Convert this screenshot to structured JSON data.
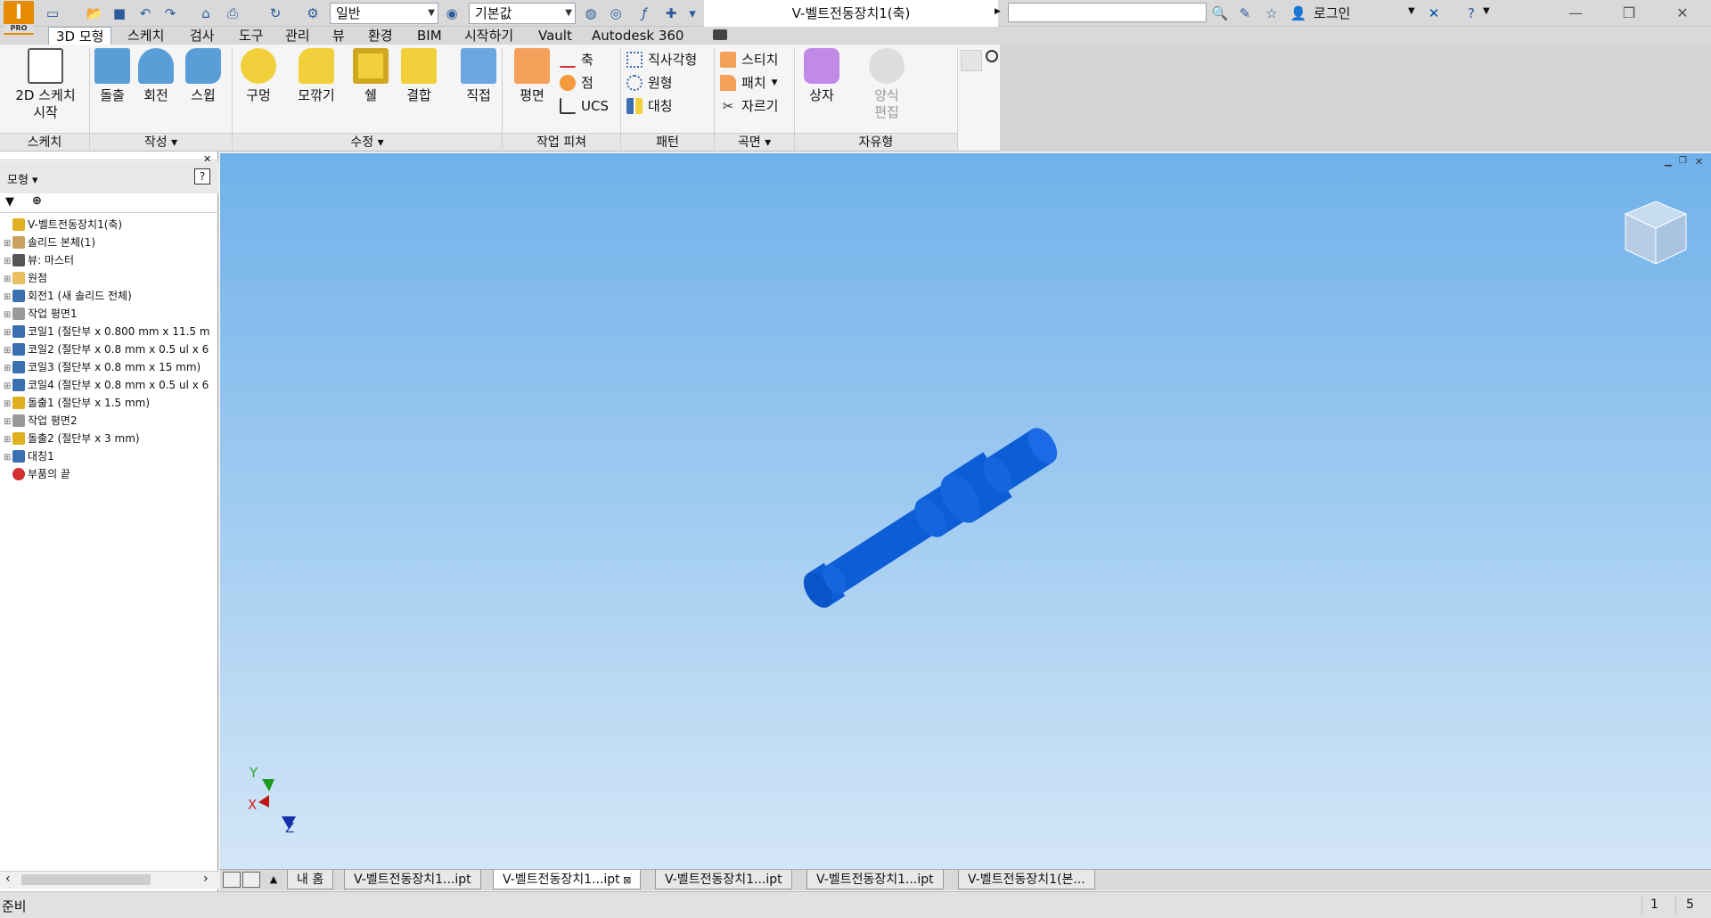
{
  "app": {
    "badge": "PRO"
  },
  "title": "V-벨트전동장치1(축)",
  "quick_access": {
    "style_dropdown": "일반",
    "material_dropdown": "기본값"
  },
  "login_label": "로그인",
  "menu_tabs": [
    "3D 모형",
    "스케치",
    "검사",
    "도구",
    "관리",
    "뷰",
    "환경",
    "BIM",
    "시작하기",
    "Vault",
    "Autodesk 360"
  ],
  "ribbon": {
    "sketch": {
      "button": "2D 스케치\n시작",
      "panel": "스케치"
    },
    "create": {
      "buttons": [
        "돌출",
        "회전",
        "스윕"
      ],
      "panel": "작성"
    },
    "modify": {
      "buttons": [
        "구멍",
        "모깎기",
        "쉘",
        "결합"
      ],
      "panel": "수정"
    },
    "direct": {
      "button": "직접"
    },
    "work_features": {
      "button": "평면",
      "small": [
        "축",
        "점",
        "UCS"
      ],
      "panel": "작업 피쳐"
    },
    "pattern": {
      "small": [
        "직사각형",
        "원형",
        "대칭"
      ],
      "panel": "패턴"
    },
    "surface": {
      "small": [
        "스티치",
        "패치",
        "자르기"
      ],
      "panel": "곡면"
    },
    "freeform": {
      "buttons": [
        "상자",
        "양식\n편집"
      ],
      "panel": "자유형"
    }
  },
  "browser": {
    "title": "모형",
    "tree": [
      {
        "label": "V-벨트전동장치1(축)",
        "color": "#e0b020"
      },
      {
        "label": "솔리드 본체(1)",
        "color": "#c8a060"
      },
      {
        "label": "뷰: 마스터",
        "color": "#555555"
      },
      {
        "label": "원점",
        "color": "#e8c060"
      },
      {
        "label": "회전1 (새 솔리드 전체)",
        "color": "#3a6fb0"
      },
      {
        "label": "작업 평면1",
        "color": "#999999"
      },
      {
        "label": "코일1 (절단부 x 0.800 mm x 11.5 m",
        "color": "#3a6fb0"
      },
      {
        "label": "코일2 (절단부 x 0.8 mm x 0.5 ul x 6",
        "color": "#3a6fb0"
      },
      {
        "label": "코일3 (절단부 x 0.8 mm x 15 mm)",
        "color": "#3a6fb0"
      },
      {
        "label": "코일4 (절단부 x 0.8 mm x 0.5 ul x 6",
        "color": "#3a6fb0"
      },
      {
        "label": "돌출1 (절단부 x 1.5 mm)",
        "color": "#e0b020"
      },
      {
        "label": "작업 평면2",
        "color": "#999999"
      },
      {
        "label": "돌출2 (절단부 x 3 mm)",
        "color": "#e0b020"
      },
      {
        "label": "대칭1",
        "color": "#3a6fb0"
      },
      {
        "label": "부품의 끝",
        "color": "#d03030"
      }
    ]
  },
  "triad": {
    "x": "X",
    "y": "Y",
    "z": "Z"
  },
  "doc_tabs": [
    "내 홈",
    "V-벨트전동장치1...ipt",
    "V-벨트전동장치1...ipt",
    "V-벨트전동장치1...ipt",
    "V-벨트전동장치1...ipt",
    "V-벨트전동장치1(본..."
  ],
  "status": {
    "text": "준비",
    "num1": "1",
    "num2": "5"
  },
  "colors": {
    "viewport_top": "#6fb1ea",
    "viewport_bottom": "#d3e6f7",
    "part": "#0d5ed6"
  }
}
